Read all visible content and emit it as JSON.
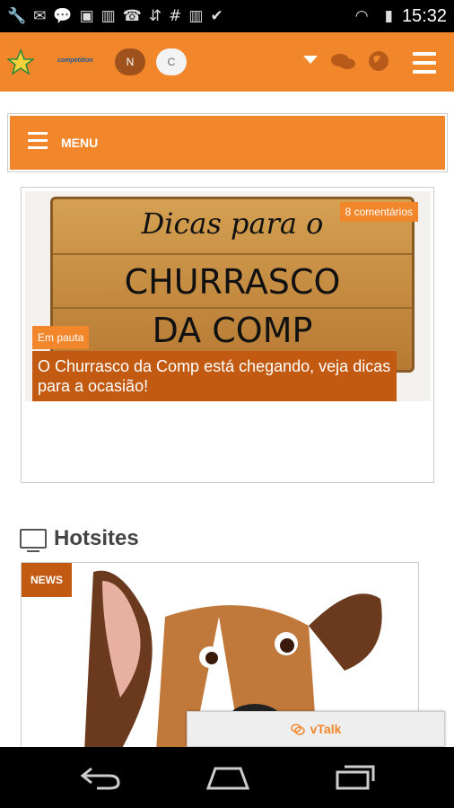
{
  "status_bar": {
    "time": "15:32",
    "icons": [
      "wrench-icon",
      "mail-icon",
      "chat-icon",
      "image-icon",
      "barcode-icon",
      "missed-call-icon",
      "sync-icon",
      "hash-icon",
      "barcode-icon",
      "briefcase-icon",
      "wifi-icon",
      "battery-icon"
    ]
  },
  "top_bar": {
    "logo_text": "competition",
    "pill_n": "N",
    "pill_c": "C"
  },
  "menu": {
    "label": "MENU"
  },
  "feature": {
    "board_line1": "Dicas para o",
    "board_line2": "CHURRASCO",
    "board_line3": "DA COMP",
    "comments": "8 comentários",
    "tag": "Em pauta",
    "caption": "O Churrasco da Comp está chegando, veja dicas para a ocasião!"
  },
  "hotsites": {
    "title": "Hotsites",
    "badge": "NEWS"
  },
  "vtalk": {
    "label": "vTalk"
  },
  "colors": {
    "accent": "#f2862b",
    "dark_accent": "#c25a12"
  }
}
